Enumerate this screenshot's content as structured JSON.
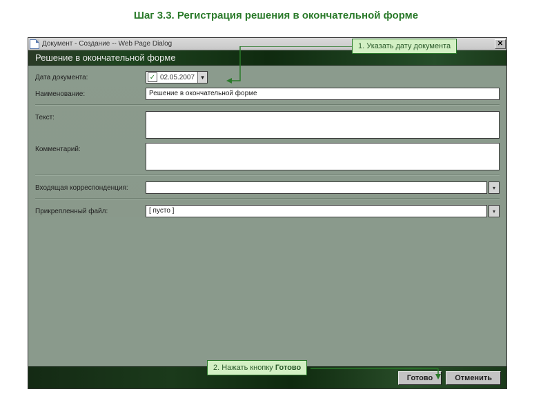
{
  "step_title": "Шаг 3.3. Регистрация решения в окончательной форме",
  "titlebar": "Документ - Создание -- Web Page Dialog",
  "header": "Решение в окончательной форме",
  "labels": {
    "date": "Дата документа:",
    "name": "Наименование:",
    "text": "Текст:",
    "comment": "Комментарий:",
    "incoming": "Входящая корреспонденция:",
    "attached": "Прикрепленный файл:"
  },
  "values": {
    "date": "02.05.2007",
    "name": "Решение в окончательной форме",
    "attached": "[ пусто ]"
  },
  "callout1": "1. Указать дату документа",
  "callout2_a": "2. Нажать кнопку ",
  "callout2_b": "Готово",
  "buttons": {
    "done": "Готово",
    "cancel": "Отменить"
  }
}
